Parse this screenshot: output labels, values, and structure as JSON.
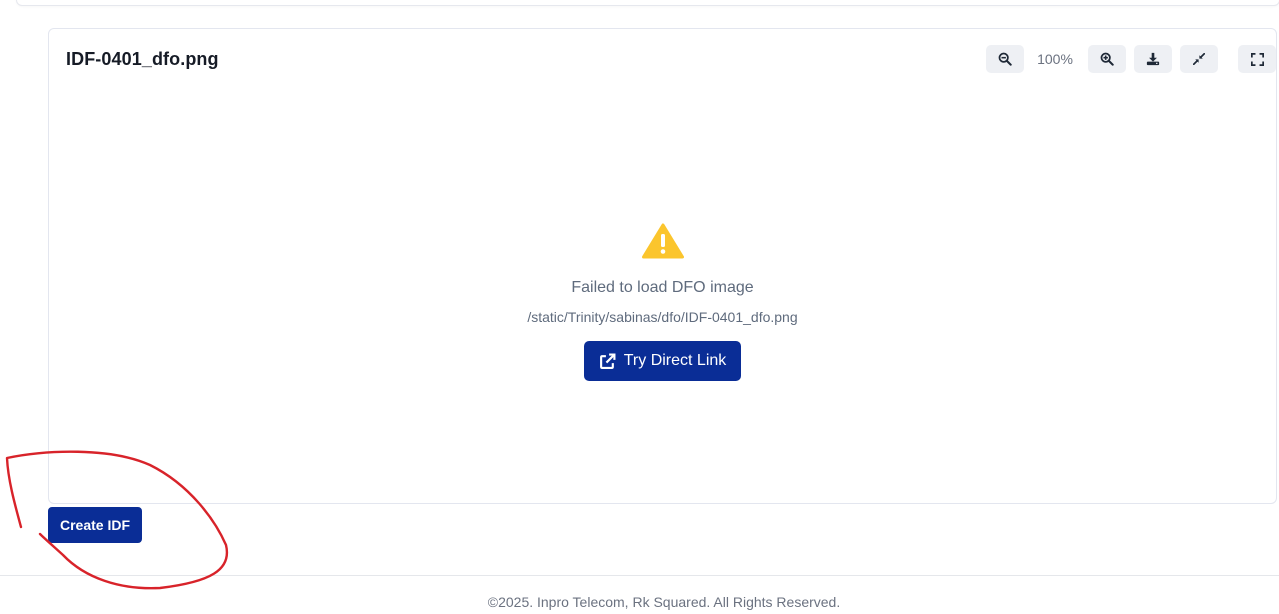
{
  "viewer": {
    "file_name": "IDF-0401_dfo.png",
    "zoom_level": "100%",
    "error_title": "Failed to load DFO image",
    "error_path": "/static/Trinity/sabinas/dfo/IDF-0401_dfo.png",
    "direct_link_label": "Try Direct Link"
  },
  "toolbar": {
    "icons": [
      "zoom-out-icon",
      "zoom-in-icon",
      "download-icon",
      "compress-icon",
      "fullscreen-icon"
    ]
  },
  "actions": {
    "create_label": "Create IDF"
  },
  "footer": {
    "copyright": "©2025. Inpro Telecom, Rk Squared. All Rights Reserved."
  },
  "colors": {
    "primary": "#0a2d96",
    "warning": "#fbc52d",
    "annotation": "#d8232a"
  }
}
